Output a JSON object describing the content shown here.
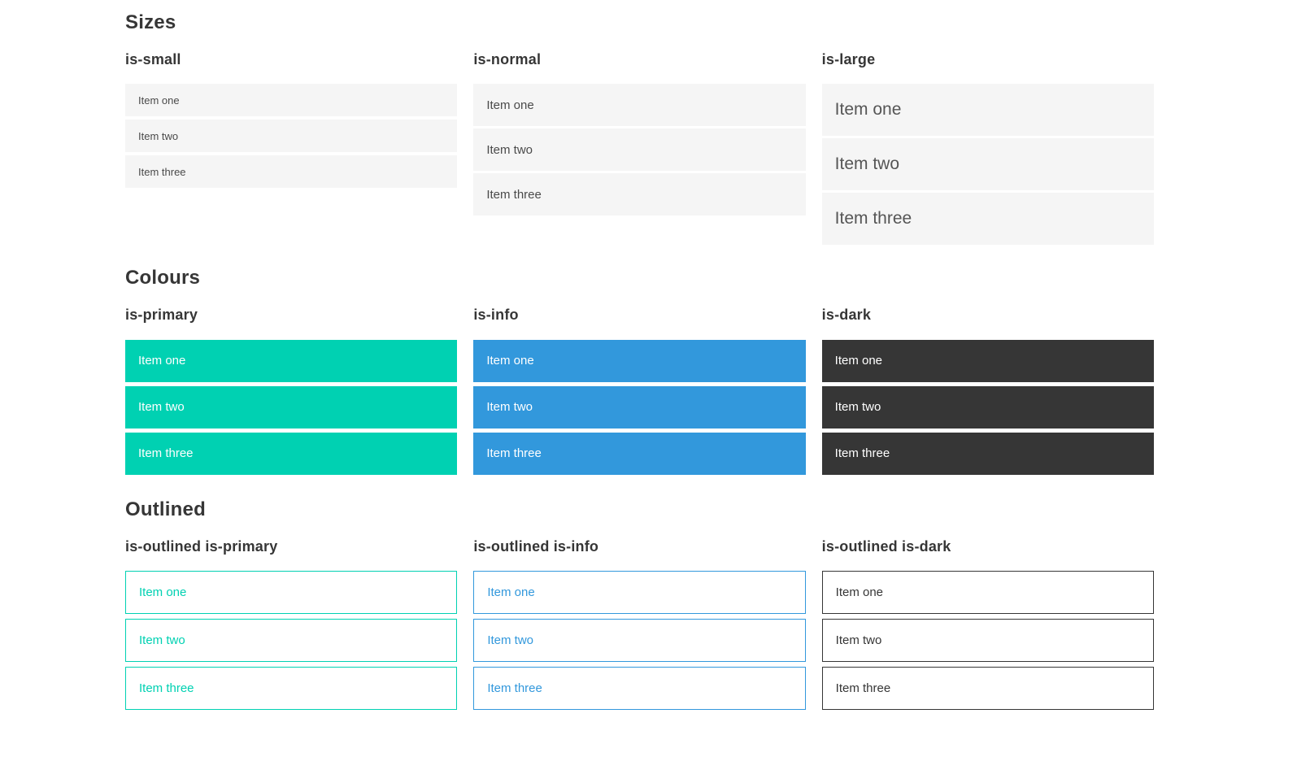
{
  "colors": {
    "primary": "#00d1b2",
    "info": "#3298dc",
    "dark": "#363636",
    "light_bg": "#f5f5f5",
    "item_text": "#4a4a4a",
    "heading": "#363636",
    "page_bg": "#ffffff"
  },
  "sections": [
    {
      "title": "Sizes",
      "groups": [
        {
          "label": "is-small",
          "items": [
            "Item one",
            "Item two",
            "Item three"
          ]
        },
        {
          "label": "is-normal",
          "items": [
            "Item one",
            "Item two",
            "Item three"
          ]
        },
        {
          "label": "is-large",
          "items": [
            "Item one",
            "Item two",
            "Item three"
          ]
        }
      ]
    },
    {
      "title": "Colours",
      "groups": [
        {
          "label": "is-primary",
          "items": [
            "Item one",
            "Item two",
            "Item three"
          ]
        },
        {
          "label": "is-info",
          "items": [
            "Item one",
            "Item two",
            "Item three"
          ]
        },
        {
          "label": "is-dark",
          "items": [
            "Item one",
            "Item two",
            "Item three"
          ]
        }
      ]
    },
    {
      "title": "Outlined",
      "groups": [
        {
          "label": "is-outlined is-primary",
          "items": [
            "Item one",
            "Item two",
            "Item three"
          ]
        },
        {
          "label": "is-outlined is-info",
          "items": [
            "Item one",
            "Item two",
            "Item three"
          ]
        },
        {
          "label": "is-outlined is-dark",
          "items": [
            "Item one",
            "Item two",
            "Item three"
          ]
        }
      ]
    }
  ]
}
